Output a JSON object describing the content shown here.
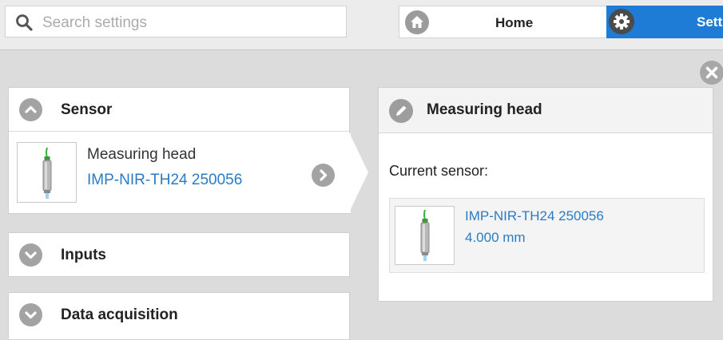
{
  "search": {
    "placeholder": "Search settings"
  },
  "nav": {
    "home_label": "Home",
    "settings_label": "Settings",
    "accent": "#1f7cd6"
  },
  "sensor_section": {
    "title": "Sensor",
    "item": {
      "name": "Measuring head",
      "model": "IMP-NIR-TH24 250056"
    }
  },
  "inputs_section": {
    "title": "Inputs"
  },
  "daq_section": {
    "title": "Data acquisition"
  },
  "detail_panel": {
    "title": "Measuring head",
    "current_label": "Current sensor:",
    "sensor": {
      "model": "IMP-NIR-TH24 250056",
      "range": "4.000 mm"
    }
  },
  "icons": {
    "search": "search-icon",
    "home": "home-icon",
    "settings": "gear-icon",
    "close": "close-icon",
    "collapse": "chevron-up-icon",
    "expand": "chevron-down-icon",
    "go": "chevron-right-icon",
    "edit": "pencil-icon"
  },
  "colors": {
    "link": "#2a7bc4",
    "icon_gray": "#a3a3a3"
  }
}
